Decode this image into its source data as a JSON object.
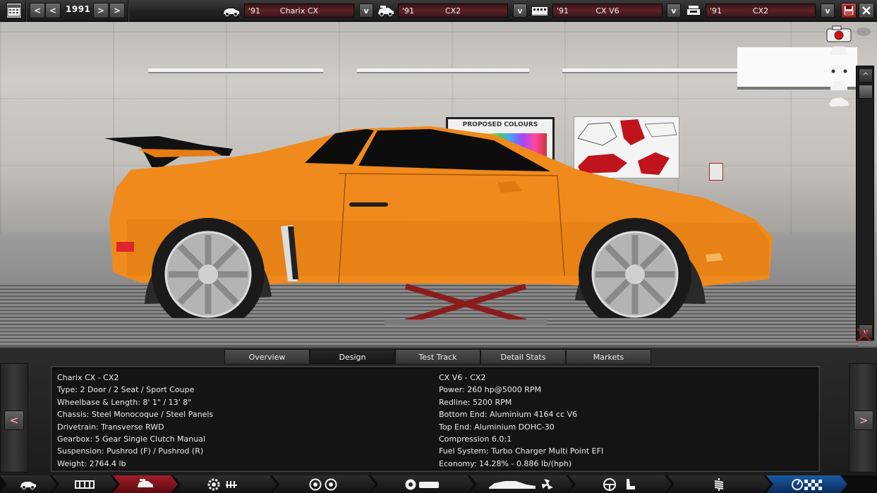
{
  "topbar": {
    "year": "1991",
    "car_model": {
      "year": "'91",
      "name": "Charix CX"
    },
    "trim": {
      "year": "'91",
      "name": "CX2"
    },
    "engine": {
      "year": "'91",
      "name": "CX V6"
    },
    "variant": {
      "year": "'91",
      "name": "CX2"
    },
    "dropdown_label": "v"
  },
  "scene": {
    "poster_title": "PROPOSED COLOURS"
  },
  "tabs": [
    "Overview",
    "Design",
    "Test Track",
    "Detail Stats",
    "Markets"
  ],
  "active_tab": "Design",
  "car_info": {
    "name": "Charix CX - CX2",
    "type": "Type: 2 Door / 2 Seat / Sport Coupe",
    "wheelbase": "Wheelbase & Length: 8' 1\" / 13' 8\"",
    "chassis": "Chassis: Steel Monocoque / Steel Panels",
    "drivetrain": "Drivetrain: Transverse RWD",
    "gearbox": "Gearbox: 5 Gear Single Clutch Manual",
    "suspension": "Suspension: Pushrod (F) / Pushrod (R)",
    "weight": "Weight: 2764.4 lb"
  },
  "engine_info": {
    "name": "CX V6 - CX2",
    "power": "Power: 260 hp@5000 RPM",
    "redline": "Redline: 5200 RPM",
    "bottom_end": "Bottom End: Aluminium 4164 cc V6",
    "top_end": "Top End: Aluminium DOHC-30",
    "compression": "Compression 6.0:1",
    "fuel_system": "Fuel System: Turbo Charger Multi Point EFI",
    "economy": "Economy: 14.28% - 0.886 lb/(hph)"
  },
  "nav_icons": [
    "car-model-icon",
    "chassis-icon",
    "body-icon",
    "engine-icon",
    "wheels-icon",
    "brakes-icon",
    "aero-icon",
    "interior-icon",
    "suspension-icon",
    "test-drive-icon"
  ],
  "colors": {
    "car_body": "#f08a1c",
    "accent_red": "#a01c28",
    "panel_bg": "#141414"
  }
}
